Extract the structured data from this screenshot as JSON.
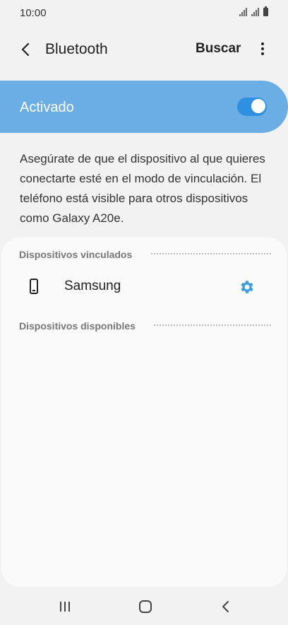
{
  "status_bar": {
    "time": "10:00"
  },
  "app_bar": {
    "title": "Bluetooth",
    "search_label": "Buscar"
  },
  "master_switch": {
    "label": "Activado",
    "on": true,
    "accent": "#6aaee5",
    "switch_color": "#2f8fe0"
  },
  "description": "Asegúrate de que el dispositivo al que quieres conectarte esté en el modo de vinculación. El teléfono está visible para otros dispositivos como Galaxy A20e.",
  "paired": {
    "header": "Dispositivos vinculados",
    "devices": [
      {
        "name": "Samsung",
        "icon": "phone-icon",
        "settings_icon": "gear-icon"
      }
    ]
  },
  "available": {
    "header": "Dispositivos disponibles"
  },
  "nav": {
    "recent_icon": "recent-apps-icon",
    "home_icon": "home-icon",
    "back_icon": "back-icon"
  }
}
